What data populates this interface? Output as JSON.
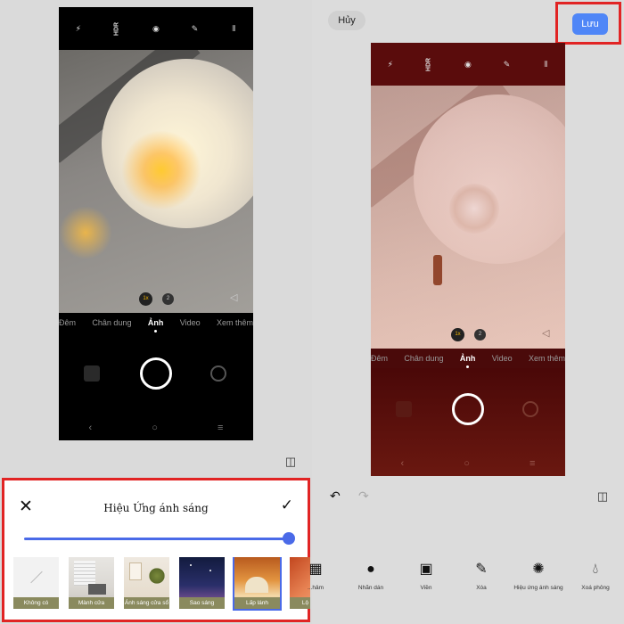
{
  "camera_left": {
    "topbar_icons": [
      "flash-off-icon",
      "hdr-icon",
      "mode-icon",
      "ai-icon",
      "menu-icon"
    ],
    "hdr_label": "HDR",
    "zoom_1x": "1x",
    "zoom_2x": "2",
    "modes": [
      "Đêm",
      "Chân dung",
      "Ảnh",
      "Video",
      "Xem thêm"
    ],
    "active_mode": "Ảnh"
  },
  "camera_right": {
    "hdr_label": "HDR",
    "zoom_1x": "1x",
    "zoom_2x": "2",
    "modes": [
      "Đêm",
      "Chân dung",
      "Ảnh",
      "Video",
      "Xem thêm"
    ],
    "active_mode": "Ảnh"
  },
  "effect_sheet": {
    "title": "Hiệu Ứng ánh sáng",
    "slider_value": 1.0,
    "presets": [
      {
        "label": "Không có",
        "selected": false
      },
      {
        "label": "Mành cửa",
        "selected": false
      },
      {
        "label": "Ánh sáng cửa sổ",
        "selected": false
      },
      {
        "label": "Sao sáng",
        "selected": false
      },
      {
        "label": "Lấp lánh",
        "selected": true
      },
      {
        "label": "Lộ sáng",
        "selected": false
      }
    ]
  },
  "editor": {
    "cancel_label": "Hủy",
    "save_label": "Lưu",
    "tools": [
      {
        "label": "...hảm",
        "icon": "mosaic-icon"
      },
      {
        "label": "Nhãn dán",
        "icon": "sticker-icon"
      },
      {
        "label": "Viền",
        "icon": "frame-icon"
      },
      {
        "label": "Xóa",
        "icon": "eraser-icon"
      },
      {
        "label": "Hiệu ứng ánh sáng",
        "icon": "light-effect-icon"
      },
      {
        "label": "Xoá phông",
        "icon": "blur-drop-icon"
      }
    ]
  },
  "colors": {
    "accent": "#4a6ae8",
    "save_button": "#4f86f7",
    "highlight_border": "#e12424"
  }
}
